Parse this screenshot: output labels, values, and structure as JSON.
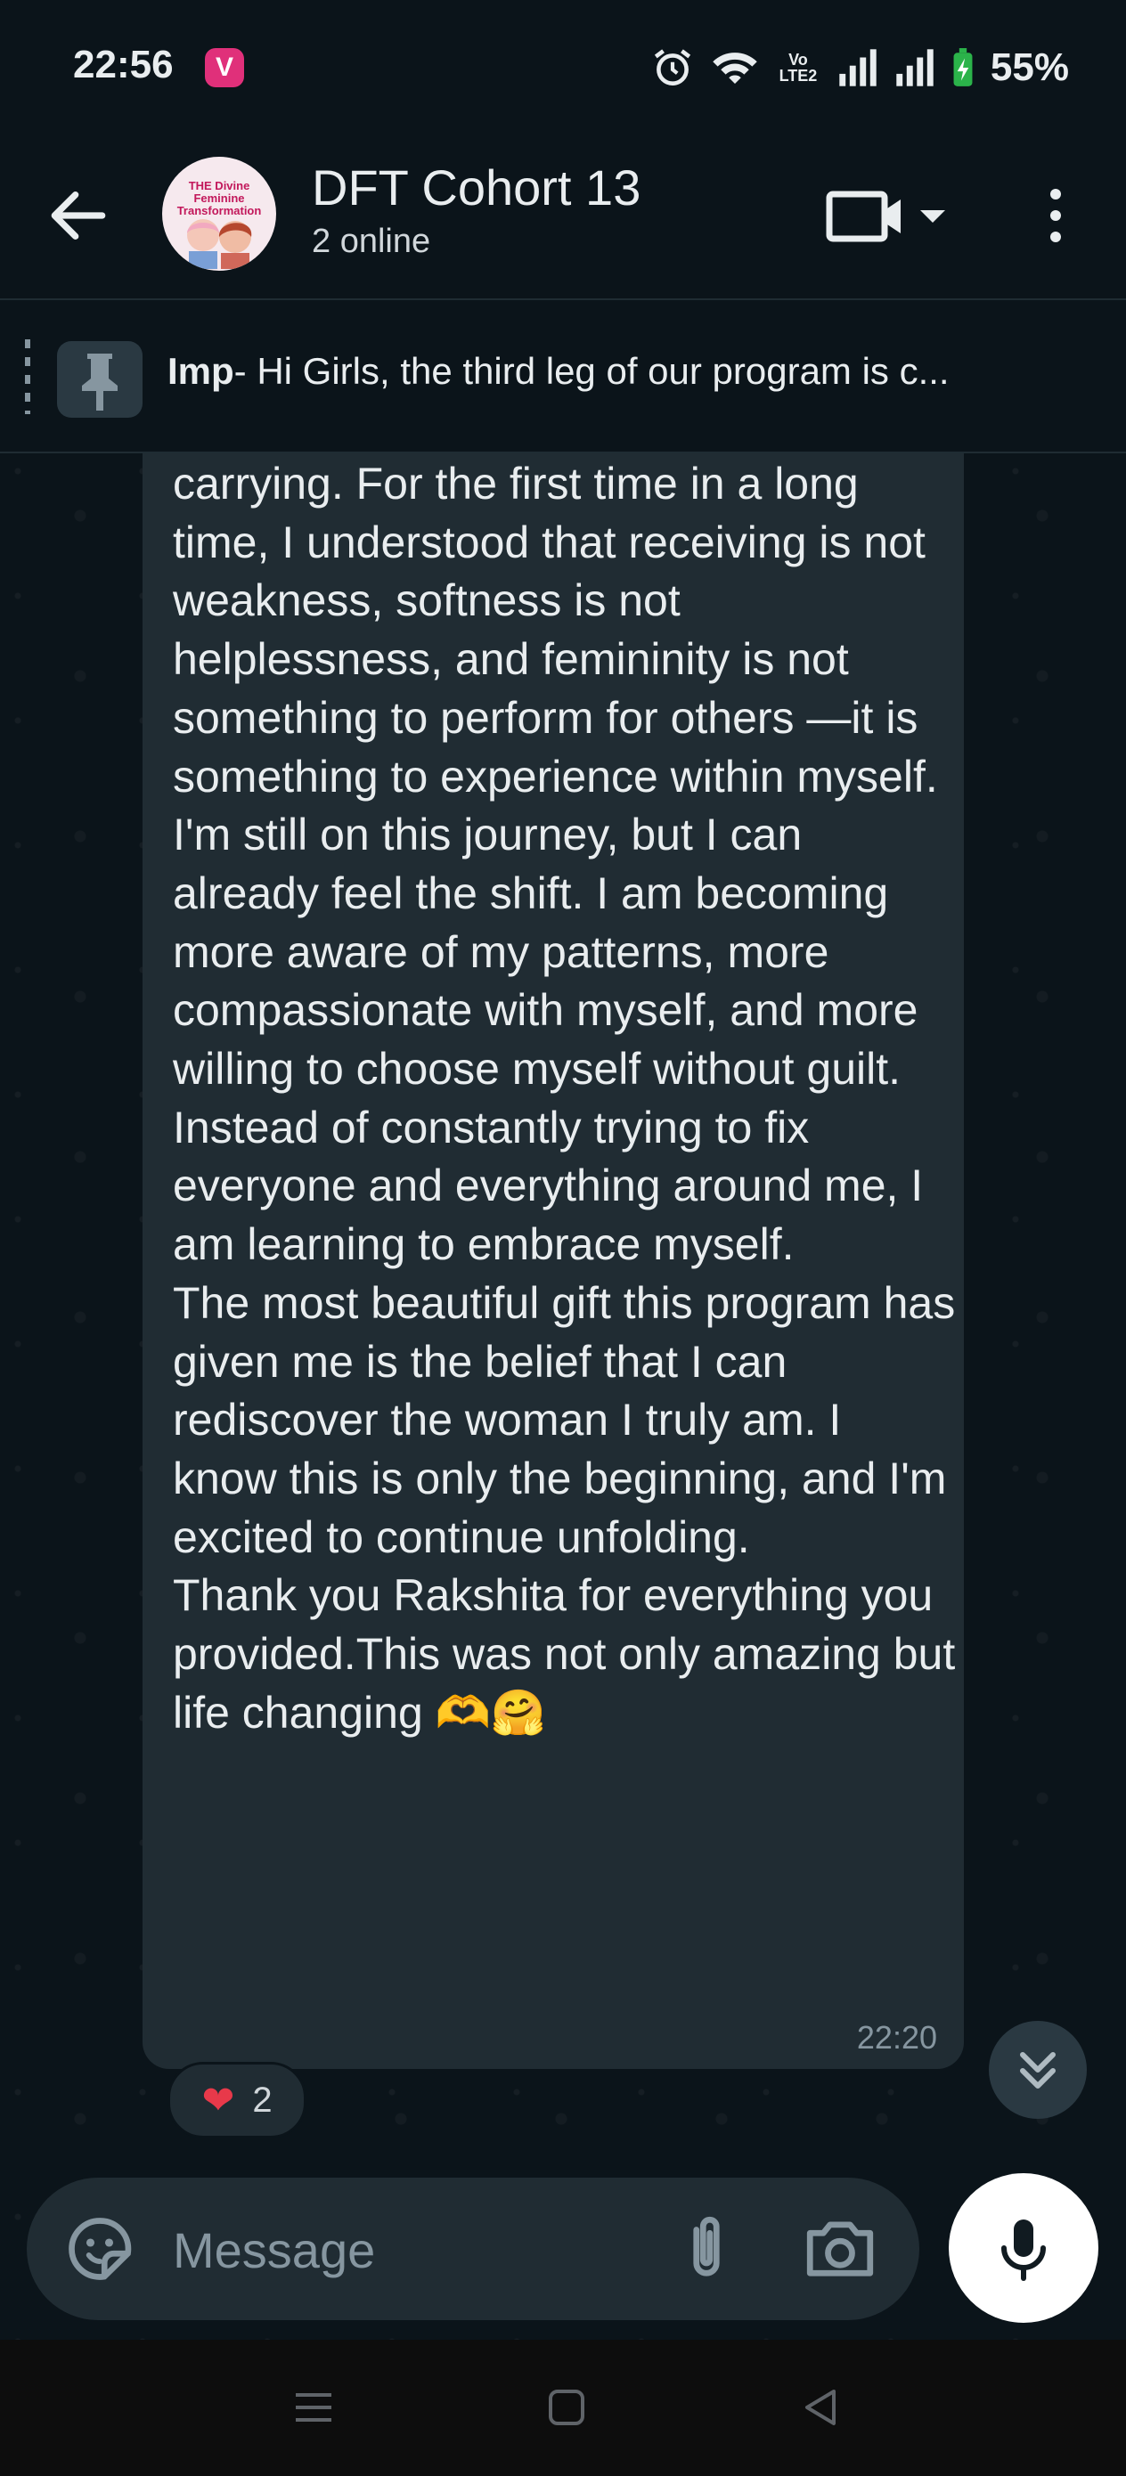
{
  "status_bar": {
    "time": "22:56",
    "app_badge": "V",
    "network": "Vo LTE2",
    "battery": "55%"
  },
  "header": {
    "avatar_text": "THE Divine Feminine Transformation",
    "title": "DFT Cohort 13",
    "subtitle": "2 online"
  },
  "pinned": {
    "prefix": "Imp",
    "text": "- Hi Girls, the third leg of our program is c..."
  },
  "message": {
    "paragraphs": [
      "carrying. For the first time in a long time, I understood that receiving is not weakness, softness is not helplessness, and femininity is not something to perform for others —it is something to experience within myself.",
      "I'm still on this journey, but I can already feel the shift. I am becoming more aware of my patterns, more compassionate with myself, and more willing to choose myself without guilt. Instead of constantly trying to fix everyone and everything around me, I am learning to embrace myself.",
      "The most beautiful gift this program has given me is the belief that I can rediscover the woman I truly am. I know this is only the beginning, and I'm excited to continue unfolding.",
      "Thank you Rakshita for everything you provided.This was not only amazing but life changing 🫶🤗"
    ],
    "time": "22:20",
    "reaction_emoji": "❤",
    "reaction_count": "2"
  },
  "composer": {
    "placeholder": "Message"
  },
  "icons": {
    "back": "arrow-left-icon",
    "video": "video-call-icon",
    "more": "more-vert-icon",
    "pin": "pin-icon",
    "emoji": "sticker-icon",
    "attach": "paperclip-icon",
    "camera": "camera-icon",
    "mic": "mic-icon",
    "scroll": "double-chevron-down-icon"
  },
  "colors": {
    "background": "#0b141a",
    "bubble": "#202c33",
    "reaction_heart": "#e8394a"
  }
}
